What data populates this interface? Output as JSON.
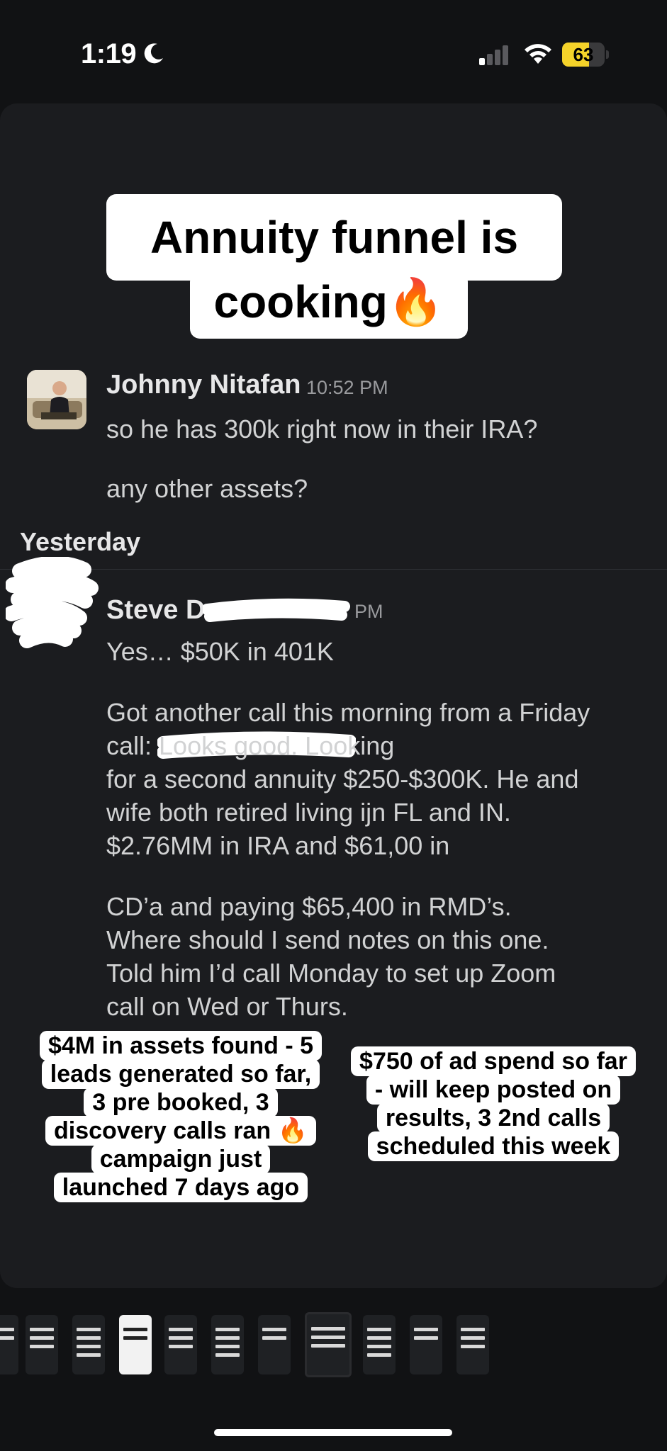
{
  "status_bar": {
    "time": "1:19",
    "battery_percent": "63",
    "battery_level": 0.63,
    "battery_color": "#f5d32a",
    "icons": [
      "moon-icon",
      "cellular-signal-icon",
      "wifi-icon",
      "battery-icon"
    ]
  },
  "headline": {
    "line1": "Annuity funnel is",
    "line2": "cooking🔥"
  },
  "messages": [
    {
      "author": "Johnny Nitafan",
      "time": "10:52 PM",
      "lines": [
        "so he has 300k right now in their IRA?",
        "any other assets?"
      ]
    }
  ],
  "day_divider": "Yesterday",
  "message2": {
    "author_visible": "Steve D",
    "time_visible": "PM",
    "line1": "Yes… $50K in 401K",
    "para1": [
      "Got another call this morning from a Friday",
      "call:                          Looks good.  Looking",
      "for a second annuity $250-$300K.  He and",
      "wife both retired living ijn FL and IN.",
      "$2.76MM in IRA and  $61,00 in"
    ],
    "para2": [
      "CD’a and paying $65,400 in RMD’s.",
      "Where should I send notes on this one.",
      "Told him I’d call Monday to set up Zoom",
      "call on Wed or Thurs."
    ]
  },
  "stickers": {
    "left": [
      "$4M in assets found - 5",
      "leads generated so far,",
      "3 pre booked, 3",
      "discovery calls ran 🔥",
      "campaign just",
      "launched 7 days ago"
    ],
    "right": [
      "$750 of ad spend so far",
      "- will keep posted on",
      "results, 3 2nd calls",
      "scheduled this week"
    ]
  },
  "thumbnails_count": 11
}
